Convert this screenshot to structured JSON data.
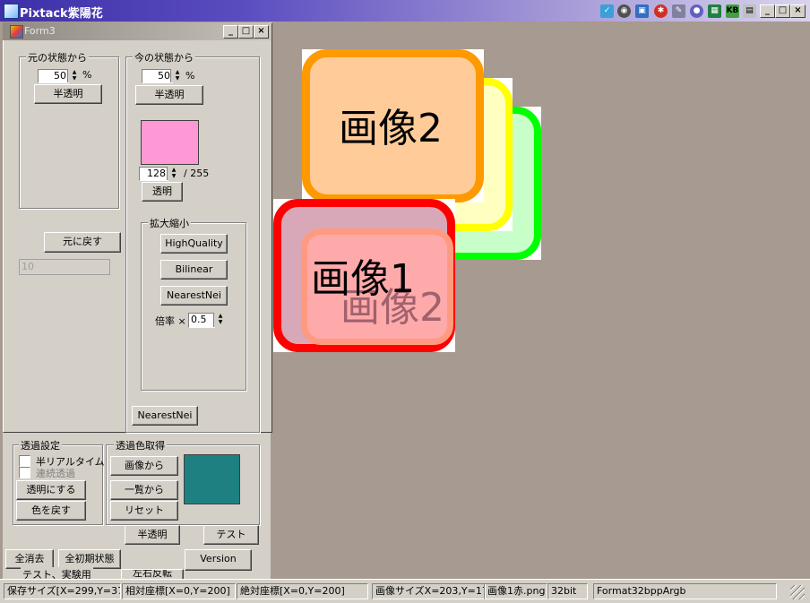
{
  "app": {
    "title": "Pixtack紫陽花"
  },
  "form3": {
    "title": "Form3",
    "group_original": {
      "label": "元の状態から",
      "opacity_value": "50",
      "percent": "%",
      "semi_button": "半透明",
      "restore_button": "元に戻す",
      "disabled_field": "10"
    },
    "group_current": {
      "label": "今の状態から",
      "opacity_value": "50",
      "percent": "%",
      "semi_button": "半透明",
      "swatch_color": "#ff99d6",
      "alpha_value": "128",
      "alpha_max": "/ 255",
      "transparent_button": "透明"
    },
    "group_scale": {
      "label": "拡大縮小",
      "buttons": [
        "HighQuality",
        "Bilinear",
        "NearestNei"
      ],
      "ratio_label": "倍率 ×",
      "ratio_value": "0.5"
    },
    "mode_button": "NearestNei"
  },
  "lower_panel": {
    "transparency_group": {
      "label": "透過設定",
      "checkbox_realtime": "半リアルタイム",
      "checkbox_continuous": "連続透過",
      "make_transparent_button": "透明にする",
      "restore_color_button": "色を戻す"
    },
    "color_pick_group": {
      "label": "透過色取得",
      "from_image_button": "画像から",
      "from_list_button": "一覧から",
      "reset_button": "リセット",
      "swatch_color": "#1e8080"
    },
    "semi_button": "半透明",
    "test_button": "テスト",
    "clear_all_button": "全消去",
    "initial_state_button": "全初期状態",
    "version_button": "Version",
    "test_experiment_label": "テスト、実験用",
    "flip_button": "左右反転"
  },
  "canvas": {
    "image2_label": "画像2",
    "image1_label": "画像1",
    "image1_overlay_label": "画像2",
    "colors": {
      "orange_border": "#ff9900",
      "orange_fill": "#ffcc99",
      "yellow_border": "#ffff00",
      "green_border": "#00ff00",
      "red_border": "#ff0000",
      "pink_fill": "#ffaaaa"
    }
  },
  "status": {
    "save_size": "保存サイズ[X=299,Y=371]",
    "relative": "相対座標[X=0,Y=200]",
    "absolute": "絶対座標[X=0,Y=200]",
    "image_size": "画像サイズX=203,Y=171",
    "filename": "画像1赤.png",
    "bitdepth": "32bit",
    "format": "Format32bppArgb"
  }
}
